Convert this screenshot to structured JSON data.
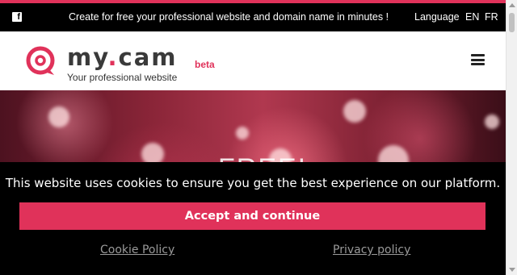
{
  "topbar": {
    "promo": "Create for free your professional website and domain name in minutes !",
    "language_label": "Language",
    "lang_en": "EN",
    "lang_fr": "FR"
  },
  "header": {
    "brand_part1": "my",
    "brand_dot": ".",
    "brand_part2": "cam",
    "beta": "beta",
    "tagline": "Your professional website"
  },
  "hero": {
    "headline": "FREE!"
  },
  "cookie_banner": {
    "message": "This website uses cookies to ensure you get the best experience on our platform.",
    "accept_label": "Accept and continue",
    "cookie_policy_link": "Cookie Policy",
    "privacy_policy_link": "Privacy policy"
  },
  "colors": {
    "accent": "#e0325a",
    "topbar_bg": "#000000",
    "banner_bg": "#000000"
  },
  "icons": {
    "social": "facebook-icon",
    "logo": "camera-lens-icon",
    "menu": "hamburger-menu-icon"
  }
}
